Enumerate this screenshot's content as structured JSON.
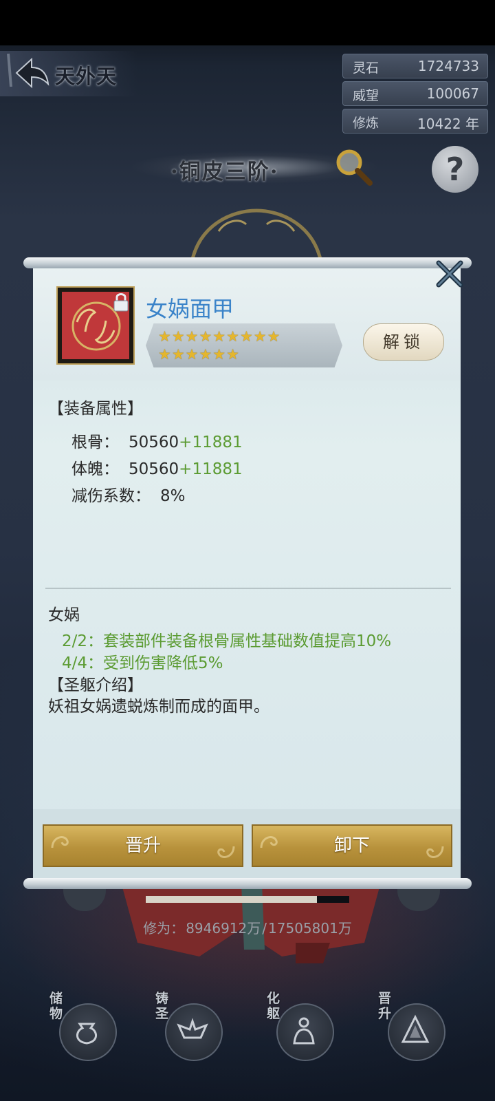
{
  "header": {
    "back_title": "天外天"
  },
  "currencies": [
    {
      "label": "灵石",
      "value": "1724733"
    },
    {
      "label": "威望",
      "value": "100067"
    },
    {
      "label": "修炼",
      "value": "10422 年"
    }
  ],
  "rank": {
    "title": "·铜皮三阶·",
    "help_glyph": "?"
  },
  "item": {
    "name": "女娲面甲",
    "stars_row1": "★★★★★★★★★",
    "stars_row2": "★★★★★★",
    "unlock_label": "解锁"
  },
  "attributes": {
    "title": "【装备属性】",
    "rows": [
      {
        "label": "根骨：",
        "base": "50560",
        "bonus": "+11881"
      },
      {
        "label": "体魄：",
        "base": "50560",
        "bonus": "+11881"
      },
      {
        "label": "减伤系数：",
        "base": "8%",
        "bonus": ""
      }
    ]
  },
  "set": {
    "name": "女娲",
    "lines": [
      "2/2：套装部件装备根骨属性基础数值提高10%",
      "4/4：受到伤害降低5%"
    ]
  },
  "intro": {
    "title": "【圣躯介绍】",
    "text": "妖祖女娲遗蜕炼制而成的面甲。"
  },
  "actions": {
    "promote": "晋升",
    "unequip": "卸下"
  },
  "cultivation": {
    "label": "修为：",
    "current": "8946912万",
    "separator": "/",
    "max": "17505801万",
    "progress_fraction": 0.84
  },
  "menu": [
    {
      "label": "储物",
      "icon": "bag-icon"
    },
    {
      "label": "铸圣",
      "icon": "forge-icon"
    },
    {
      "label": "化躯",
      "icon": "body-icon"
    },
    {
      "label": "晋升",
      "icon": "ascend-icon"
    }
  ],
  "colors": {
    "item_name": "#3a83c9",
    "bonus_green": "#5b9b32",
    "gold_button": "#c4a04a"
  }
}
